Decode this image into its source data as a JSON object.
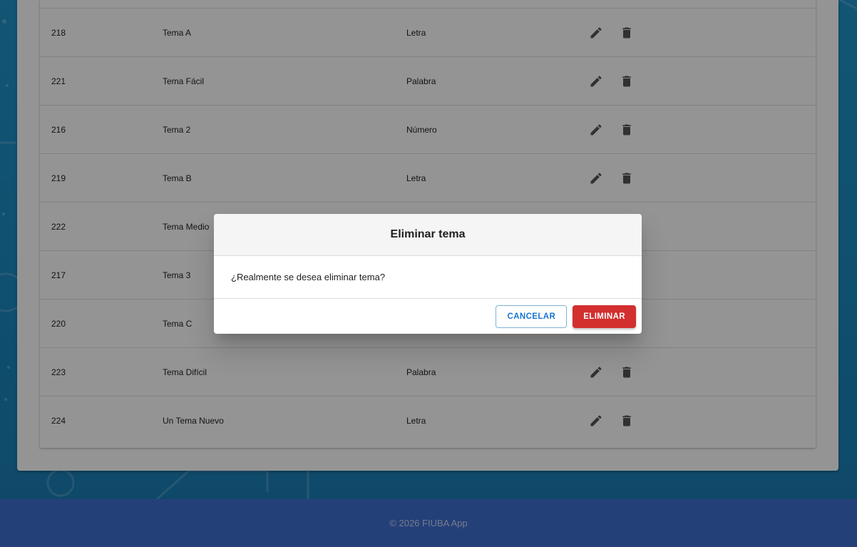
{
  "table": {
    "rows": [
      {
        "id": "218",
        "name": "Tema A",
        "type": "Letra"
      },
      {
        "id": "221",
        "name": "Tema Fácil",
        "type": "Palabra"
      },
      {
        "id": "216",
        "name": "Tema 2",
        "type": "Número"
      },
      {
        "id": "219",
        "name": "Tema B",
        "type": "Letra"
      },
      {
        "id": "222",
        "name": "Tema Medio",
        "type": ""
      },
      {
        "id": "217",
        "name": "Tema 3",
        "type": ""
      },
      {
        "id": "220",
        "name": "Tema C",
        "type": ""
      },
      {
        "id": "223",
        "name": "Tema Difícil",
        "type": "Palabra"
      },
      {
        "id": "224",
        "name": "Un Tema Nuevo",
        "type": "Letra"
      }
    ],
    "action_icons": [
      "edit-icon",
      "delete-icon"
    ]
  },
  "dialog": {
    "title": "Eliminar tema",
    "message": "¿Realmente se desea eliminar tema?",
    "cancel_label": "CANCELAR",
    "confirm_label": "ELIMINAR"
  },
  "footer": {
    "text": "© 2026 FIUBA App"
  },
  "colors": {
    "background": "#1f93c9",
    "footer": "#3f6fd1",
    "delete_button": "#d32f2f",
    "cancel_text": "#1976d2"
  }
}
